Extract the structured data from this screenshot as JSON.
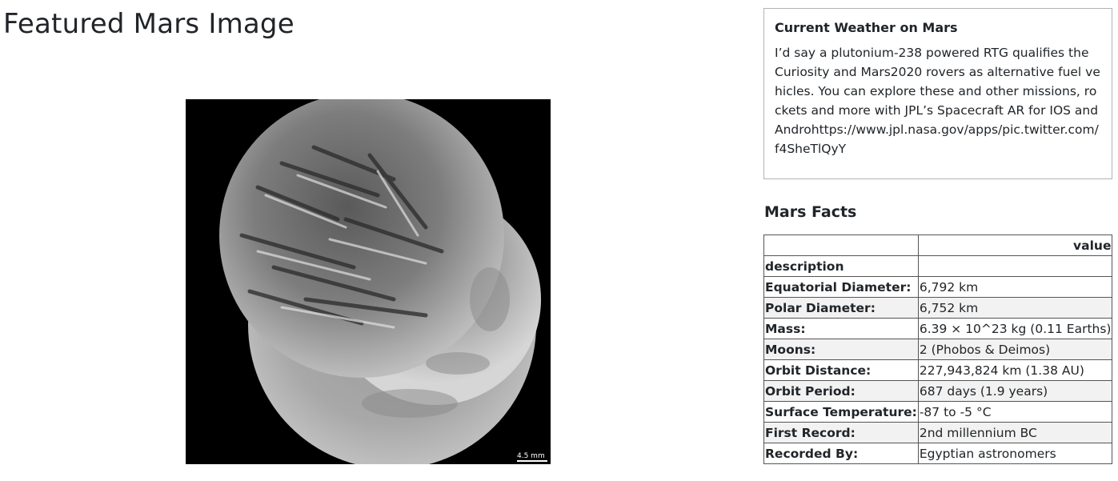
{
  "featured": {
    "title": "Featured Mars Image",
    "image_alt": "Featured Mars Image",
    "scale_label": "4.5 mm"
  },
  "weather": {
    "title": "Current Weather on Mars",
    "text": "I’d say a plutonium-238 powered RTG qualifies the Curiosity and Mars2020 rovers as alternative fuel vehicles. You can explore these and other missions, rockets and more with JPL’s Spacecraft AR for IOS and Androhttps://www.jpl.nasa.gov/apps/pic.twitter.com/f4SheTlQyY"
  },
  "facts": {
    "title": "Mars Facts",
    "header_value": "value",
    "header_index": "description",
    "rows": [
      {
        "label": "Equatorial Diameter:",
        "value": "6,792 km"
      },
      {
        "label": "Polar Diameter:",
        "value": "6,752 km"
      },
      {
        "label": "Mass:",
        "value": "6.39 × 10^23 kg (0.11 Earths)"
      },
      {
        "label": "Moons:",
        "value": "2 (Phobos & Deimos)"
      },
      {
        "label": "Orbit Distance:",
        "value": "227,943,824 km (1.38 AU)"
      },
      {
        "label": "Orbit Period:",
        "value": "687 days (1.9 years)"
      },
      {
        "label": "Surface Temperature:",
        "value": "-87 to -5 °C"
      },
      {
        "label": "First Record:",
        "value": "2nd millennium BC"
      },
      {
        "label": "Recorded By:",
        "value": "Egyptian astronomers"
      }
    ]
  }
}
